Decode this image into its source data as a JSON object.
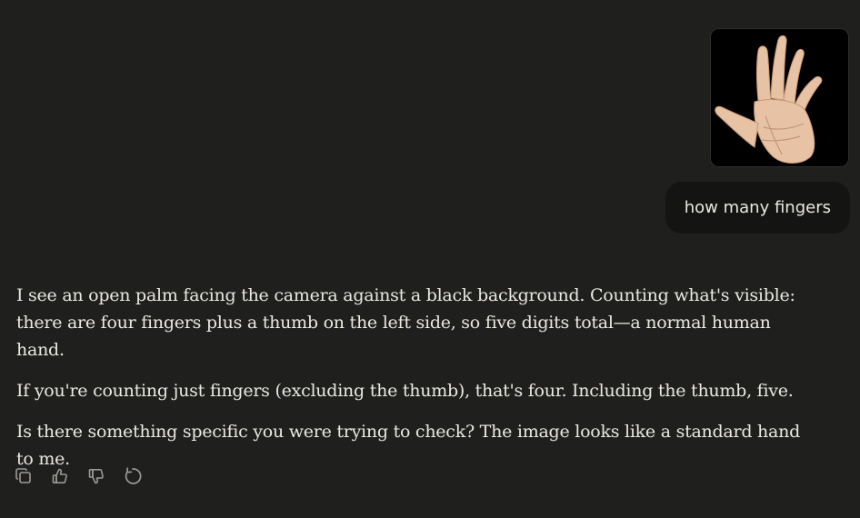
{
  "user_message": {
    "image_alt": "open palm",
    "text": "how many fingers"
  },
  "assistant_message": {
    "paragraphs": [
      "I see an open palm facing the camera against a black background. Counting what's visible: there are four fingers plus a thumb on the left side, so five digits total—a normal human hand.",
      "If you're counting just fingers (excluding the thumb), that's four. Including the thumb, five.",
      "Is there something specific you were trying to check? The image looks like a standard hand to me."
    ]
  },
  "actions": [
    {
      "icon": "copy-icon"
    },
    {
      "icon": "thumbs-up-icon"
    },
    {
      "icon": "thumbs-down-icon"
    },
    {
      "icon": "retry-icon"
    }
  ],
  "colors": {
    "background": "#1f1f1e",
    "user_bubble": "#141413",
    "text": "#eae8e1",
    "icon": "#9b9a95"
  }
}
